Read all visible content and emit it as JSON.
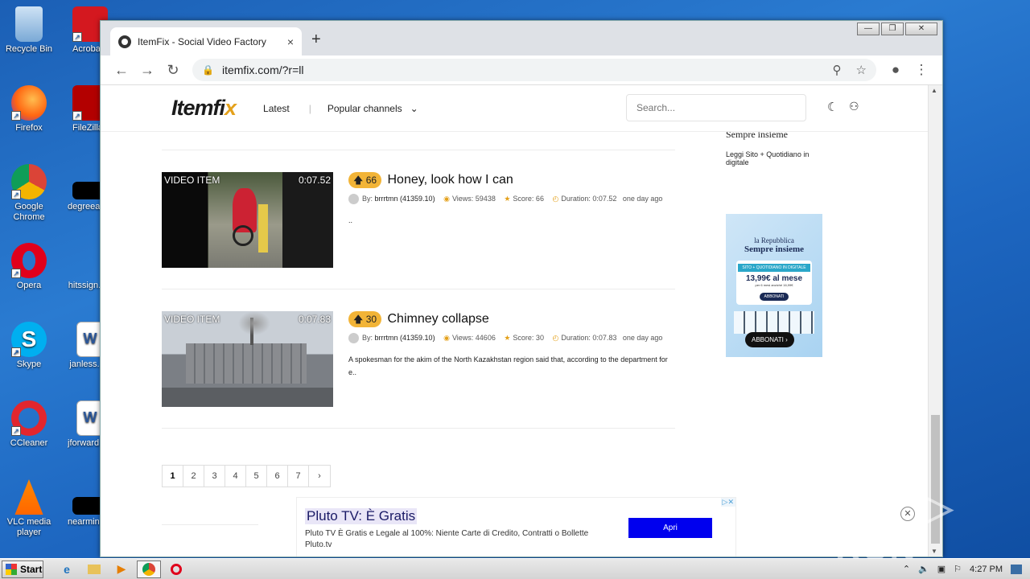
{
  "desktop": {
    "icons": [
      {
        "label": "Recycle Bin"
      },
      {
        "label": "Acrobat Reader DC"
      },
      {
        "label": "Firefox"
      },
      {
        "label": "FileZilla Client"
      },
      {
        "label": "Google Chrome"
      },
      {
        "label": "degreeacti..."
      },
      {
        "label": "Opera"
      },
      {
        "label": "hitssign..."
      },
      {
        "label": "Skype"
      },
      {
        "label": "janless..."
      },
      {
        "label": "CCleaner"
      },
      {
        "label": "jforward..."
      },
      {
        "label": "VLC media player"
      },
      {
        "label": "nearminu..."
      }
    ]
  },
  "browser": {
    "tab_title": "ItemFix - Social Video Factory",
    "tab_close": "×",
    "new_tab": "+",
    "url": "itemfix.com/?r=ll",
    "window_controls": [
      "—",
      "❐",
      "✕"
    ]
  },
  "site": {
    "logo_main": "Itemfi",
    "logo_x": "x",
    "nav_latest": "Latest",
    "nav_sep": "|",
    "nav_popular": "Popular channels",
    "search_placeholder": "Search...",
    "videos": [
      {
        "badge": "VIDEO ITEM",
        "duration": "0:07.52",
        "score": "66",
        "title": "Honey, look how I can",
        "by_label": "By:",
        "author": "brrrtmn (41359.10)",
        "views": "Views: 59438",
        "score_label": "Score: 66",
        "duration_label": "Duration: 0:07.52",
        "time": "one day ago",
        "desc": ".."
      },
      {
        "badge": "VIDEO ITEM",
        "duration": "0:07.83",
        "score": "30",
        "title": "Chimney collapse",
        "by_label": "By:",
        "author": "brrrtmn (41359.10)",
        "views": "Views: 44606",
        "score_label": "Score: 30",
        "duration_label": "Duration: 0:07.83",
        "time": "one day ago",
        "desc": "A spokesman for the akim of the North Kazakhstan region said that, according to the department for e.."
      }
    ],
    "pagination": [
      "1",
      "2",
      "3",
      "4",
      "5",
      "6",
      "7",
      "›"
    ],
    "side_ad_top": {
      "headline": "Sempre insieme",
      "sub": "Leggi Sito + Quotidiano in digitale"
    },
    "side_ad": {
      "brand": "la Repubblica",
      "tagline": "Sempre insieme",
      "band": "SITO + QUOTIDIANO IN DIGITALE",
      "price": "13,99€ al mese",
      "small": "per 6 mesi anziché 16,99€",
      "cta_small": "ABBONATI",
      "cta": "ABBONATI ›"
    },
    "bottom_ad": {
      "headline": "Pluto TV: È Gratis",
      "desc": "Pluto TV È Gratis e Legale al 100%: Niente Carte di Credito, Contratti o Bollette Pluto.tv",
      "button": "Apri",
      "adx": "▷✕"
    }
  },
  "watermark": "ANY ▷ RUN",
  "taskbar": {
    "start": "Start",
    "time": "4:27 PM"
  }
}
